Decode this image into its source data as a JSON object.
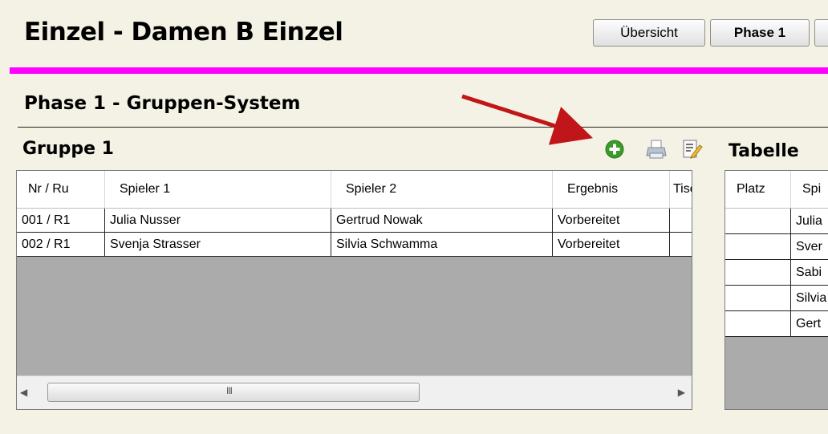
{
  "header": {
    "title": "Einzel - Damen B Einzel",
    "buttons": [
      "Übersicht",
      "Phase 1",
      ""
    ]
  },
  "phase": {
    "title": "Phase 1 - Gruppen-System"
  },
  "group": {
    "title": "Gruppe 1",
    "toolbar": {
      "icons": [
        "add-icon",
        "print-icon",
        "edit-icon"
      ]
    },
    "columns": [
      "Nr / Ru",
      "Spieler 1",
      "Spieler 2",
      "Ergebnis",
      "Tisc"
    ],
    "rows": [
      [
        "001 / R1",
        "Julia Nusser",
        "Gertrud Nowak",
        "Vorbereitet",
        ""
      ],
      [
        "002 / R1",
        "Svenja Strasser",
        "Silvia Schwamma",
        "Vorbereitet",
        ""
      ]
    ],
    "scroll": {
      "left": "◀",
      "right": "▶",
      "grip": "III"
    }
  },
  "table": {
    "title": "Tabelle",
    "columns": [
      "Platz",
      "Spi"
    ],
    "rows": [
      [
        "",
        "Julia"
      ],
      [
        "",
        "Sver"
      ],
      [
        "",
        "Sabi"
      ],
      [
        "",
        "Silvia"
      ],
      [
        "",
        "Gert"
      ]
    ]
  },
  "colors": {
    "accent": "#ff00ff",
    "arrow": "#c0161a",
    "add_icon": "#3a9b2a",
    "background": "#f4f2e4",
    "grid_empty": "#ababab"
  }
}
